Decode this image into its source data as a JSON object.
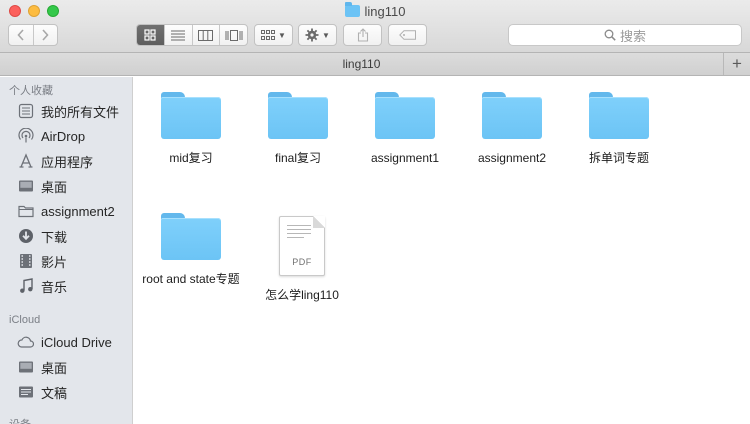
{
  "window": {
    "title": "ling110"
  },
  "toolbar": {
    "search_placeholder": "搜索"
  },
  "tabbar": {
    "tab_label": "ling110",
    "add_label": "+"
  },
  "sidebar": {
    "favorites_header": "个人收藏",
    "favorites": [
      {
        "label": "我的所有文件",
        "icon": "all-files-icon"
      },
      {
        "label": "AirDrop",
        "icon": "airdrop-icon"
      },
      {
        "label": "应用程序",
        "icon": "applications-icon"
      },
      {
        "label": "桌面",
        "icon": "desktop-icon"
      },
      {
        "label": "assignment2",
        "icon": "folder-icon"
      },
      {
        "label": "下载",
        "icon": "downloads-icon"
      },
      {
        "label": "影片",
        "icon": "movies-icon"
      },
      {
        "label": "音乐",
        "icon": "music-icon"
      }
    ],
    "icloud_header": "iCloud",
    "icloud": [
      {
        "label": "iCloud Drive",
        "icon": "cloud-icon"
      },
      {
        "label": "桌面",
        "icon": "desktop-icon"
      },
      {
        "label": "文稿",
        "icon": "documents-icon"
      }
    ],
    "devices_header": "设备"
  },
  "files": [
    {
      "name": "mid复习",
      "kind": "folder"
    },
    {
      "name": "final复习",
      "kind": "folder"
    },
    {
      "name": "assignment1",
      "kind": "folder"
    },
    {
      "name": "assignment2",
      "kind": "folder"
    },
    {
      "name": "拆单词专题",
      "kind": "folder"
    },
    {
      "name": "root and state专题",
      "kind": "folder"
    },
    {
      "name": "怎么学ling110",
      "kind": "pdf",
      "badge": "PDF"
    }
  ],
  "colors": {
    "folder_blue": "#7fd0fb",
    "sidebar_bg": "#e3e6eb",
    "close": "#fc605c",
    "minimize": "#fdbc40",
    "maximize": "#34c84a"
  }
}
